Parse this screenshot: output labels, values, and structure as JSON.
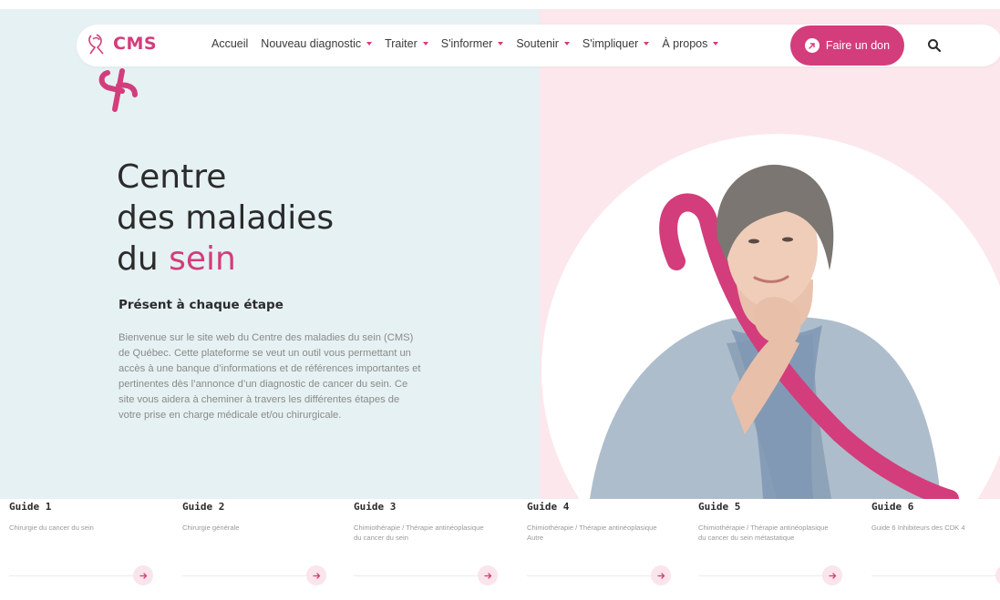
{
  "brand": {
    "name": "CMS",
    "accent_color": "#d33d7c",
    "left_bg": "#e6f1f3",
    "right_bg": "#fbe7ec"
  },
  "nav": {
    "items": [
      {
        "label": "Accueil",
        "has_caret": false
      },
      {
        "label": "Nouveau diagnostic",
        "has_caret": true
      },
      {
        "label": "Traiter",
        "has_caret": true
      },
      {
        "label": "S'informer",
        "has_caret": true
      },
      {
        "label": "Soutenir",
        "has_caret": true
      },
      {
        "label": "S'impliquer",
        "has_caret": true
      },
      {
        "label": "À propos",
        "has_caret": true
      }
    ],
    "donate_label": "Faire un don"
  },
  "hero": {
    "title_line1": "Centre",
    "title_line2": "des maladies",
    "title_line3_prefix": "du ",
    "title_line3_accent": "sein",
    "subtitle": "Présent à chaque étape",
    "intro": "Bienvenue sur le site web du Centre des maladies du sein (CMS) de Québec. Cette plateforme se veut un outil vous permettant un accès à une banque d’informations et de références importantes et pertinentes dès l’annonce d’un diagnostic de cancer du sein. Ce site vous aidera à cheminer à travers les différentes étapes de votre prise en charge médicale et/ou chirurgicale."
  },
  "guides": [
    {
      "title": "Guide 1",
      "desc": "Chirurgie du cancer du sein"
    },
    {
      "title": "Guide 2",
      "desc": "Chirurgie générale"
    },
    {
      "title": "Guide 3",
      "desc": "Chimiothérapie / Thérapie antinéoplasique du cancer du sein"
    },
    {
      "title": "Guide 4",
      "desc": "Chimiothérapie / Thérapie antinéoplasique Autre"
    },
    {
      "title": "Guide 5",
      "desc": "Chimiothérapie / Thérapie antinéoplasique du cancer du sein métastatique"
    },
    {
      "title": "Guide 6",
      "desc": "Guide 6 Inhibiteurs des CDK 4"
    }
  ],
  "icons": [
    "ribbon-logo-icon",
    "caret-down-icon",
    "donate-arrow-icon",
    "search-icon",
    "arrow-right-icon"
  ]
}
